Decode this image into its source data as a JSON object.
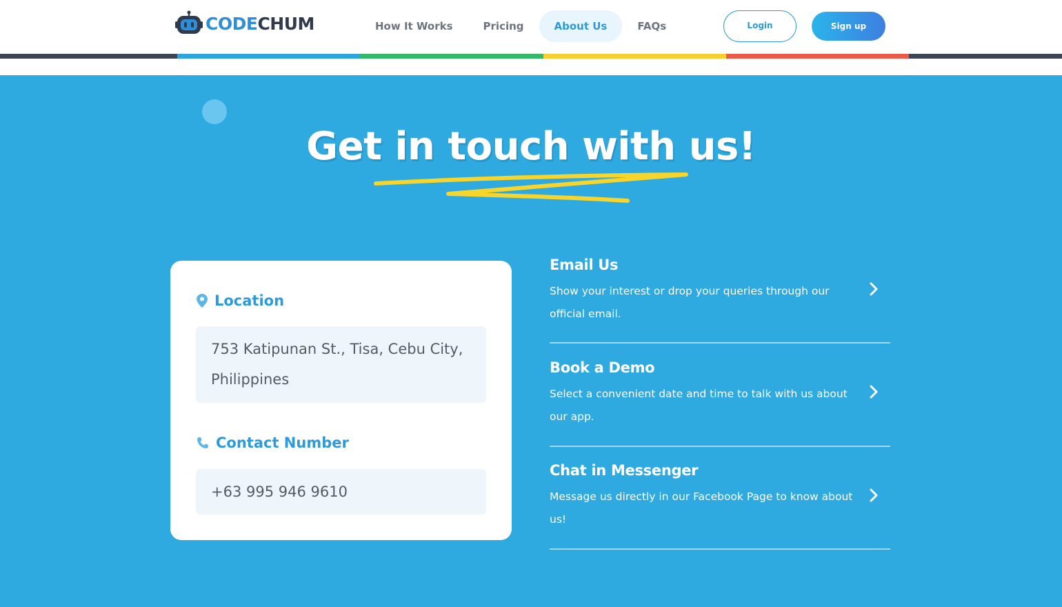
{
  "header": {
    "logo": {
      "part1": "CODE",
      "part2": "CHUM"
    },
    "nav": [
      "How It Works",
      "Pricing",
      "About Us",
      "FAQs"
    ],
    "active_nav": "About Us",
    "login_label": "Login",
    "signup_label": "Sign up"
  },
  "stripe_colors": [
    "#3d4654",
    "#2ea4e0",
    "#35b86a",
    "#f6cf30",
    "#ea5a49",
    "#3d4654"
  ],
  "hero": {
    "title": "Get in touch with us!"
  },
  "card": {
    "location_label": "Location",
    "location_line1": "753 Katipunan St., Tisa, Cebu City,",
    "location_line2": "Philippines",
    "contact_label": "Contact Number",
    "contact_value": "+63 995 946 9610"
  },
  "contact_options": [
    {
      "title": "Email Us",
      "desc_line1": "Show your interest or drop your queries through our",
      "desc_line2": "official email."
    },
    {
      "title": "Book a Demo",
      "desc_line1": "Select a convenient date and time to talk with us about",
      "desc_line2": "our app."
    },
    {
      "title": "Chat in Messenger",
      "desc_line1": "Message us directly in our Facebook Page to know about",
      "desc_line2": "us!"
    }
  ],
  "colors": {
    "background": "#2eaae1",
    "accent": "#2e9bd8",
    "scribble": "#f7d52b"
  },
  "icons": {
    "location": "map-pin-icon",
    "contact": "phone-icon",
    "chevron": "chevron-right-icon",
    "logo": "robot-logo-icon"
  }
}
